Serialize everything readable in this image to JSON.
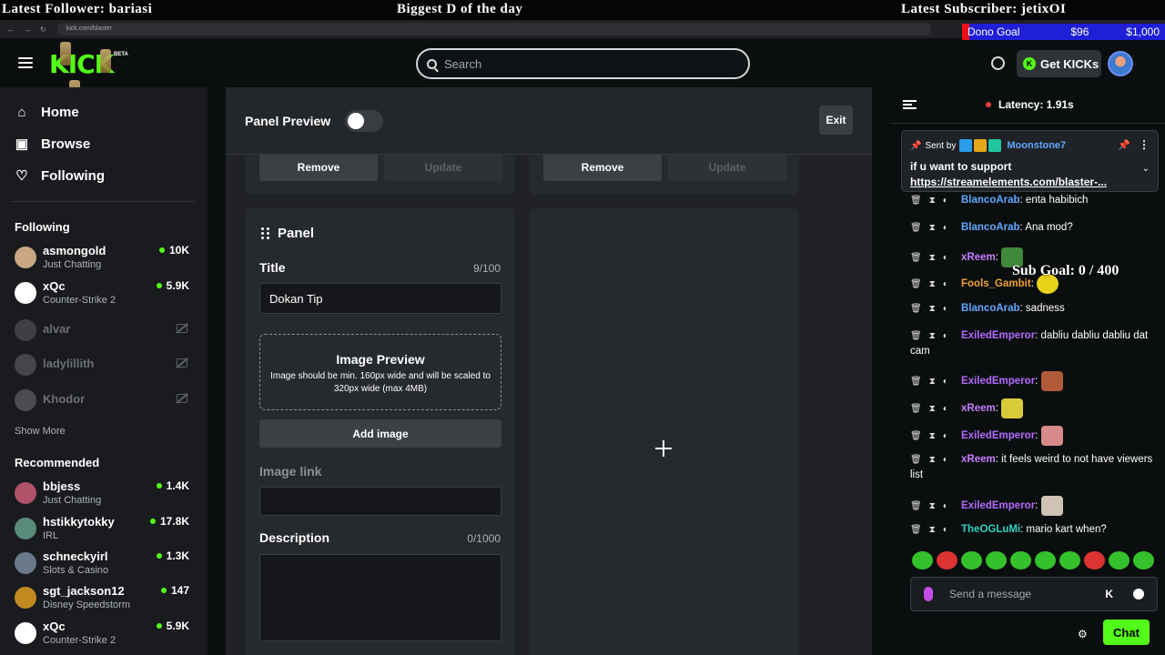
{
  "overlay": {
    "latest_follower": "Latest Follower: bariasi",
    "banner": "Biggest D of the day",
    "latest_subscriber": "Latest Subscriber: jetixOI",
    "dono_label": "Dono Goal",
    "dono_raised": "$96",
    "dono_goal": "$1,000",
    "sub_goal": "Sub Goal: 0 / 400"
  },
  "browser": {
    "url": "kick.com/blaster"
  },
  "header": {
    "logo": "KICK",
    "logo_badge": "BETA",
    "search_placeholder": "Search",
    "get_kicks": "Get KICKs"
  },
  "sidebar": {
    "nav": [
      {
        "label": "Home",
        "icon": "home-icon"
      },
      {
        "label": "Browse",
        "icon": "browse-icon"
      },
      {
        "label": "Following",
        "icon": "heart-icon"
      }
    ],
    "following_title": "Following",
    "following": [
      {
        "name": "asmongold",
        "category": "Just Chatting",
        "viewers": "10K",
        "color": "#c9a684"
      },
      {
        "name": "xQc",
        "category": "Counter-Strike 2",
        "viewers": "5.9K",
        "color": "#ffffff"
      },
      {
        "name": "alvar",
        "offline": true,
        "color": "#888888"
      },
      {
        "name": "ladylillith",
        "offline": true,
        "color": "#999999"
      },
      {
        "name": "Khodor",
        "offline": true,
        "color": "#aaaaaa"
      }
    ],
    "show_more": "Show More",
    "recommended_title": "Recommended",
    "recommended": [
      {
        "name": "bbjess",
        "category": "Just Chatting",
        "viewers": "1.4K",
        "color": "#b0526a"
      },
      {
        "name": "hstikkytokky",
        "category": "IRL",
        "viewers": "17.8K",
        "color": "#5a8a7a"
      },
      {
        "name": "schneckyirl",
        "category": "Slots & Casino",
        "viewers": "1.3K",
        "color": "#6b7a8a"
      },
      {
        "name": "sgt_jackson12",
        "category": "Disney Speedstorm",
        "viewers": "147",
        "color": "#c08a20"
      },
      {
        "name": "xQc",
        "category": "Counter-Strike 2",
        "viewers": "5.9K",
        "color": "#ffffff"
      }
    ]
  },
  "editor": {
    "panel_preview_label": "Panel Preview",
    "exit_label": "Exit",
    "remove_label": "Remove",
    "update_label": "Update",
    "panel_heading": "Panel",
    "title_label": "Title",
    "title_count": "9/100",
    "title_value": "Dokan Tip",
    "image_preview_title": "Image Preview",
    "image_preview_hint": "Image should be min. 160px wide and will be scaled to 320px wide (max 4MB)",
    "add_image_label": "Add image",
    "image_link_label": "Image link",
    "image_link_value": "",
    "description_label": "Description",
    "description_count": "0/1000",
    "description_value": ""
  },
  "chat": {
    "latency": "Latency: 1.91s",
    "pinned": {
      "sent_by": "Sent by",
      "user": "Moonstone7",
      "message": "if u want to support",
      "link": "https://streamelements.com/blaster-..."
    },
    "messages": [
      {
        "user": "BlancoArab",
        "text": ": enta habibich",
        "color": "#5fa8ff"
      },
      {
        "user": "BlancoArab",
        "text": ": Ana mod?",
        "color": "#5fa8ff"
      },
      {
        "user": "xReem",
        "text": ":",
        "color": "#c77dff"
      },
      {
        "user": "Fools_Gambit",
        "text": ":",
        "color": "#f0a030"
      },
      {
        "user": "BlancoArab",
        "text": ": sadness",
        "color": "#5fa8ff"
      },
      {
        "user": "ExiledEmperor",
        "text": ": dabliu dabliu dabliu dat cam",
        "color": "#b36bff"
      },
      {
        "user": "ExiledEmperor",
        "text": ":",
        "color": "#b36bff"
      },
      {
        "user": "xReem",
        "text": ":",
        "color": "#c77dff"
      },
      {
        "user": "ExiledEmperor",
        "text": ":",
        "color": "#b36bff"
      },
      {
        "user": "xReem",
        "text": ": it feels weird to not have viewers list",
        "color": "#c77dff"
      },
      {
        "user": "ExiledEmperor",
        "text": ":",
        "color": "#b36bff"
      },
      {
        "user": "TheOGLuMi",
        "text": ": mario kart when?",
        "color": "#2ed1c0"
      }
    ],
    "input_placeholder": "Send a message",
    "chat_button": "Chat"
  }
}
